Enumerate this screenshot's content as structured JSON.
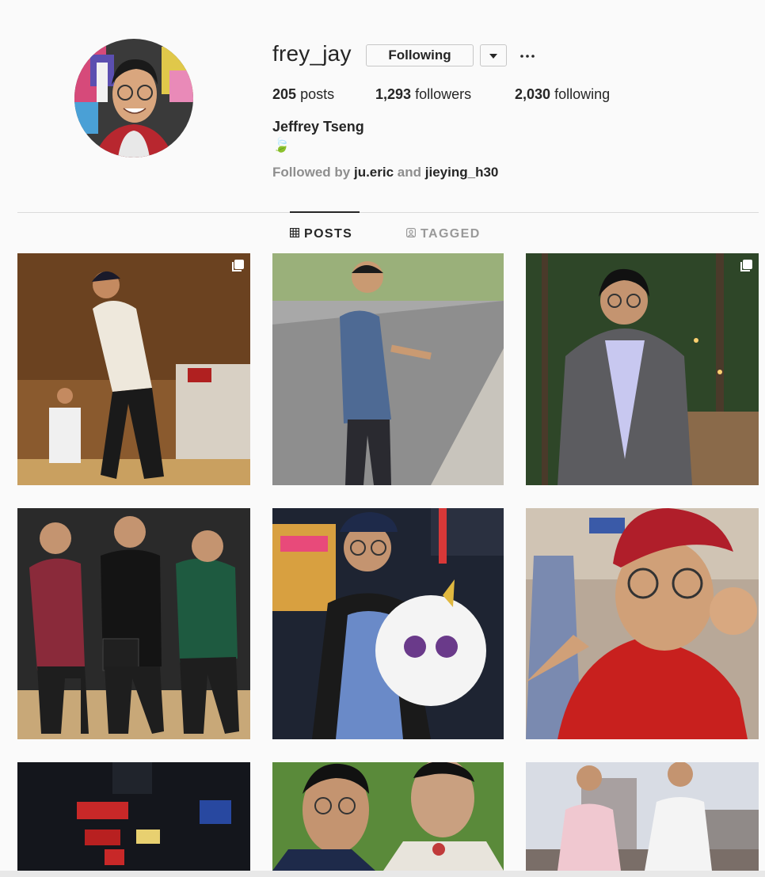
{
  "profile": {
    "username": "frey_jay",
    "full_name": "Jeffrey Tseng",
    "bio_emoji": "🍃",
    "follow_button_label": "Following",
    "more_icon": "ellipsis-icon",
    "dropdown_icon": "caret-down-icon",
    "stats": [
      {
        "count": "205",
        "label": "posts"
      },
      {
        "count": "1,293",
        "label": "followers"
      },
      {
        "count": "2,030",
        "label": "following"
      }
    ],
    "followed_by_prefix": "Followed by",
    "followed_by_accounts": [
      "ju.eric",
      "jieying_h30"
    ],
    "followed_by_joiner": "and"
  },
  "tabs": [
    {
      "label": "POSTS",
      "icon": "grid-icon",
      "active": true
    },
    {
      "label": "TAGGED",
      "icon": "tag-person-icon",
      "active": false
    }
  ],
  "posts": [
    {
      "subject": "dance-performance",
      "multi_photo": true
    },
    {
      "subject": "street-peace-sign",
      "multi_photo": false
    },
    {
      "subject": "forest-blazer",
      "multi_photo": true
    },
    {
      "subject": "three-friends-gym",
      "multi_photo": false
    },
    {
      "subject": "carnival-plush-unicorn",
      "multi_photo": false
    },
    {
      "subject": "red-cap-selfie",
      "multi_photo": false
    },
    {
      "subject": "korean-night-signs",
      "multi_photo": false
    },
    {
      "subject": "two-guys-pouting",
      "multi_photo": false
    },
    {
      "subject": "city-skyline-duo",
      "multi_photo": false
    }
  ],
  "colors": {
    "text": "#262626",
    "muted": "#8e8e8e",
    "border": "#dbdbdb",
    "background": "#fafafa"
  }
}
